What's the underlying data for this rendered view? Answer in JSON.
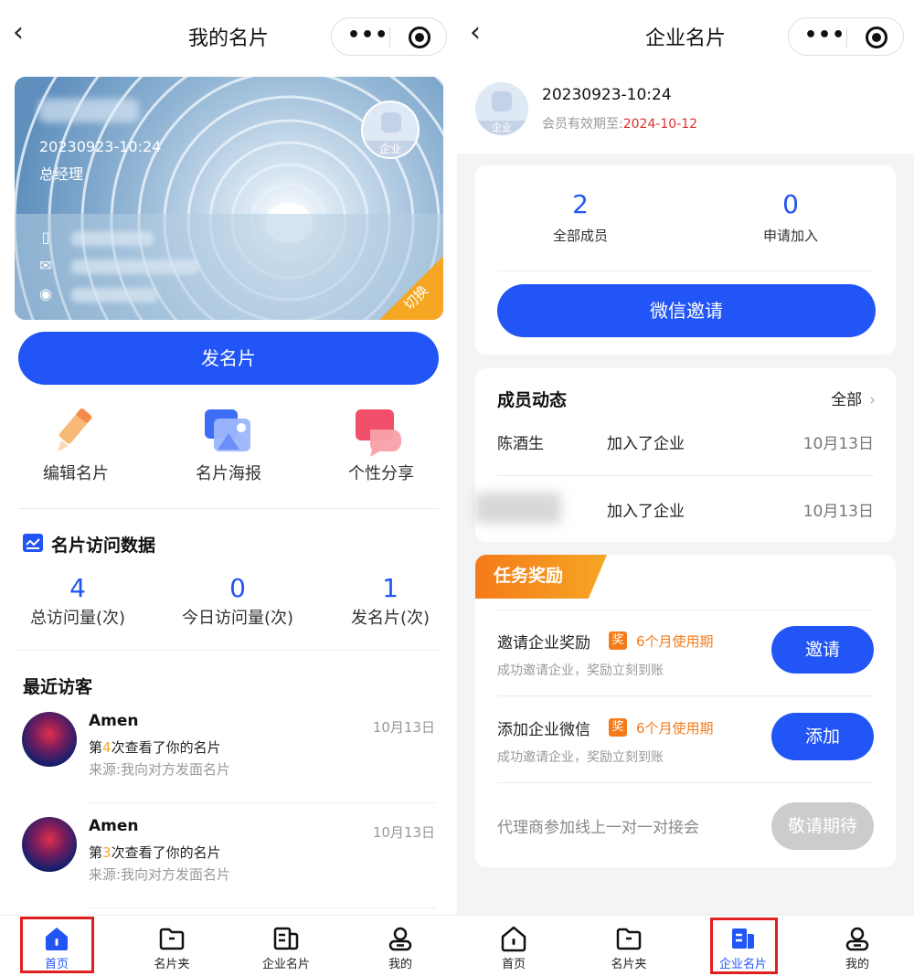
{
  "left": {
    "navbar": {
      "back": "‹",
      "title": "我的名片"
    },
    "card": {
      "id_line": "20230923-10:24",
      "role": "总经理",
      "avatar_tag": "企业",
      "switch_label": "切换"
    },
    "send_button": "发名片",
    "quick_actions": [
      {
        "label": "编辑名片",
        "icon": "pencil-icon"
      },
      {
        "label": "名片海报",
        "icon": "poster-icon"
      },
      {
        "label": "个性分享",
        "icon": "share-icon"
      }
    ],
    "stats_section": {
      "title": "名片访问数据",
      "items": [
        {
          "value": "4",
          "label": "总访问量(次)"
        },
        {
          "value": "0",
          "label": "今日访问量(次)"
        },
        {
          "value": "1",
          "label": "发名片(次)"
        }
      ]
    },
    "visitors_section": {
      "title": "最近访客",
      "items": [
        {
          "name": "Amen",
          "prefix": "第",
          "count": "4",
          "suffix": "次查看了你的名片",
          "source": "来源:我向对方发面名片",
          "date": "10月13日"
        },
        {
          "name": "Amen",
          "prefix": "第",
          "count": "3",
          "suffix": "次查看了你的名片",
          "source": "来源:我向对方发面名片",
          "date": "10月13日"
        }
      ]
    },
    "tabbar": {
      "items": [
        {
          "label": "首页",
          "icon": "home-icon",
          "active": true
        },
        {
          "label": "名片夹",
          "icon": "folder-icon",
          "active": false
        },
        {
          "label": "企业名片",
          "icon": "company-card-icon",
          "active": false
        },
        {
          "label": "我的",
          "icon": "user-icon",
          "active": false
        }
      ]
    }
  },
  "right": {
    "navbar": {
      "back": "‹",
      "title": "企业名片"
    },
    "member": {
      "name": "20230923-10:24",
      "avatar_tag": "企业",
      "expiry_label": "会员有效期至:",
      "expiry_date": "2024-10-12"
    },
    "members_panel": {
      "stats": [
        {
          "value": "2",
          "label": "全部成员"
        },
        {
          "value": "0",
          "label": "申请加入"
        }
      ],
      "invite_button": "微信邀请"
    },
    "activity_panel": {
      "title": "成员动态",
      "more": "全部",
      "rows": [
        {
          "who": "陈酒生",
          "what": "加入了企业",
          "date": "10月13日"
        },
        {
          "who": "",
          "what": "加入了企业",
          "date": "10月13日"
        }
      ]
    },
    "tasks_panel": {
      "ribbon": "任务奖励",
      "tasks": [
        {
          "title": "邀请企业奖励",
          "badge": "奖",
          "reward": "6个月使用期",
          "sub": "成功邀请企业，奖励立刻到账",
          "button": "邀请",
          "enabled": true
        },
        {
          "title": "添加企业微信",
          "badge": "奖",
          "reward": "6个月使用期",
          "sub": "成功邀请企业，奖励立刻到账",
          "button": "添加",
          "enabled": true
        },
        {
          "title": "代理商参加线上一对一对接会",
          "badge": "",
          "reward": "",
          "sub": "",
          "button": "敬请期待",
          "enabled": false
        }
      ]
    },
    "tabbar": {
      "items": [
        {
          "label": "首页",
          "icon": "home-icon",
          "active": false
        },
        {
          "label": "名片夹",
          "icon": "folder-icon",
          "active": false
        },
        {
          "label": "企业名片",
          "icon": "company-card-icon",
          "active": true
        },
        {
          "label": "我的",
          "icon": "user-icon",
          "active": false
        }
      ]
    }
  },
  "colors": {
    "primary": "#2255f5",
    "accent_orange": "#f57b1a",
    "highlight_red": "#e02020",
    "expiry_red": "#e03030"
  }
}
